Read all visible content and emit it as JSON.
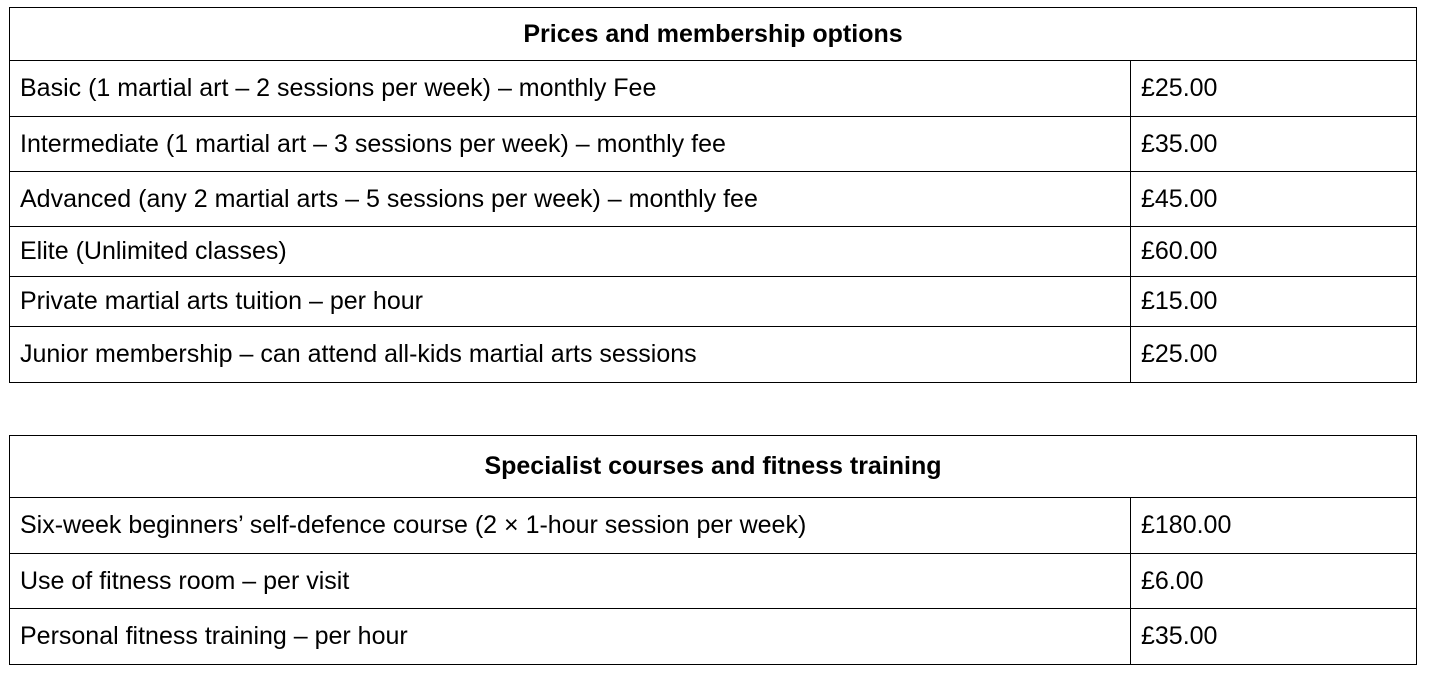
{
  "membership": {
    "title": "Prices and membership options",
    "rows": [
      {
        "label": "Basic (1 martial art – 2 sessions per week) – monthly Fee",
        "price": "£25.00"
      },
      {
        "label": "Intermediate (1 martial art – 3 sessions per week) – monthly fee",
        "price": "£35.00"
      },
      {
        "label": "Advanced (any 2 martial arts – 5 sessions per week) – monthly fee",
        "price": "£45.00"
      },
      {
        "label": "Elite (Unlimited classes)",
        "price": "£60.00"
      },
      {
        "label": "Private martial arts tuition – per hour",
        "price": "£15.00"
      },
      {
        "label": "Junior membership – can attend all-kids martial arts sessions",
        "price": "£25.00"
      }
    ]
  },
  "specialist": {
    "title": "Specialist courses and fitness training",
    "rows": [
      {
        "label": "Six-week beginners’ self-defence course (2 × 1-hour session per week)",
        "price": "£180.00"
      },
      {
        "label": "Use of fitness room – per visit",
        "price": "£6.00"
      },
      {
        "label": "Personal fitness training – per hour",
        "price": "£35.00"
      }
    ]
  }
}
